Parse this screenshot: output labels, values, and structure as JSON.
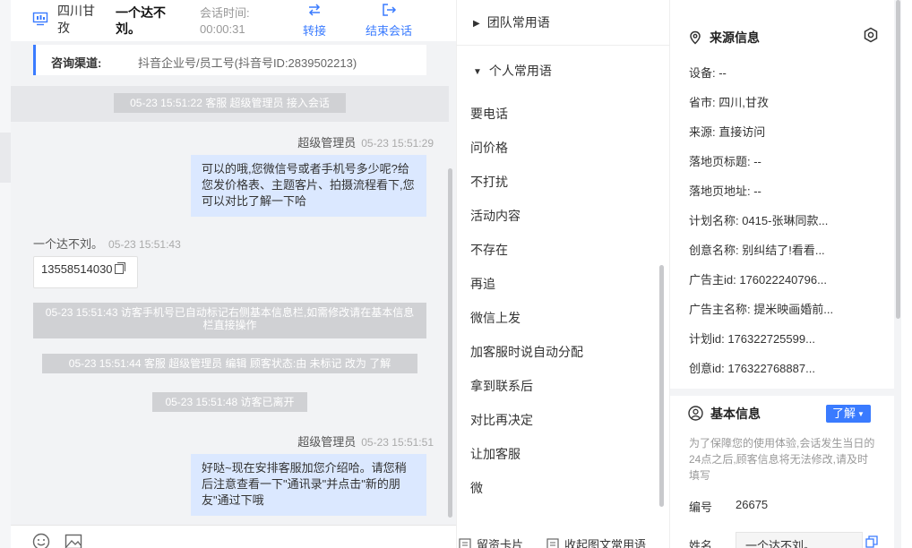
{
  "header": {
    "location": "四川甘孜",
    "visitor_name": "一个达不刘。",
    "session_time_label": "会话时间:",
    "session_time_value": "00:00:31",
    "transfer_label": "转接",
    "end_label": "结束会话"
  },
  "channel": {
    "label": "咨询渠道:",
    "value": "抖音企业号/员工号(抖音号ID:2839502213)"
  },
  "messages": {
    "sys1": "05-23 15:51:22 客服 超级管理员 接入会话",
    "agent1_sender": "超级管理员",
    "agent1_time": "05-23 15:51:29",
    "agent1_text": "可以的哦,您微信号或者手机号多少呢?给您发价格表、主题客片、拍摄流程看下,您可以对比了解一下哈",
    "visitor_sender": "一个达不刘。",
    "visitor_time": "05-23 15:51:43",
    "visitor_text": "13558514030",
    "sys2": "05-23 15:51:43 访客手机号已自动标记右侧基本信息栏,如需修改请在基本信息栏直接操作",
    "sys3": "05-23 15:51:44 客服 超级管理员 编辑 顾客状态:由 未标记 改为 了解",
    "sys4": "05-23 15:51:48 访客已离开",
    "agent2_sender": "超级管理员",
    "agent2_time": "05-23 15:51:51",
    "agent2_text": "好哒~现在安排客服加您介绍哈。请您稍后注意查看一下\"通讯录\"并点击\"新的朋友\"通过下哦"
  },
  "phrases": {
    "team_group": "团队常用语",
    "personal_group": "个人常用语",
    "items": [
      "要电话",
      "问价格",
      "不打扰",
      "活动内容",
      "不存在",
      "再追",
      "微信上发",
      "加客服时说自动分配",
      "拿到联系后",
      "对比再决定",
      "让加客服",
      "微"
    ],
    "footer_card": "留资卡片",
    "footer_collapse": "收起图文常用语"
  },
  "source": {
    "title": "来源信息",
    "rows": [
      "设备: --",
      "省市: 四川,甘孜",
      "来源: 直接访问",
      "落地页标题: --",
      "落地页地址: --",
      "计划名称: 0415-张琳同款...",
      "创意名称: 别纠结了!看看...",
      "广告主id: 176022240796...",
      "广告主名称: 提米映画婚前...",
      "计划id: 176322725599...",
      "创意id: 176322768887..."
    ]
  },
  "basic": {
    "title": "基本信息",
    "status_tag": "了解",
    "note": "为了保障您的使用体验,会话发生当日的24点之后,顾客信息将无法修改,请及时填写",
    "id_label": "编号",
    "id_value": "26675",
    "name_label": "姓名",
    "name_value": "一个达不刘。"
  },
  "colors": {
    "accent": "#3a7bff",
    "bubble_out": "#dbe8ff",
    "system_msg": "#d0d1d4"
  }
}
